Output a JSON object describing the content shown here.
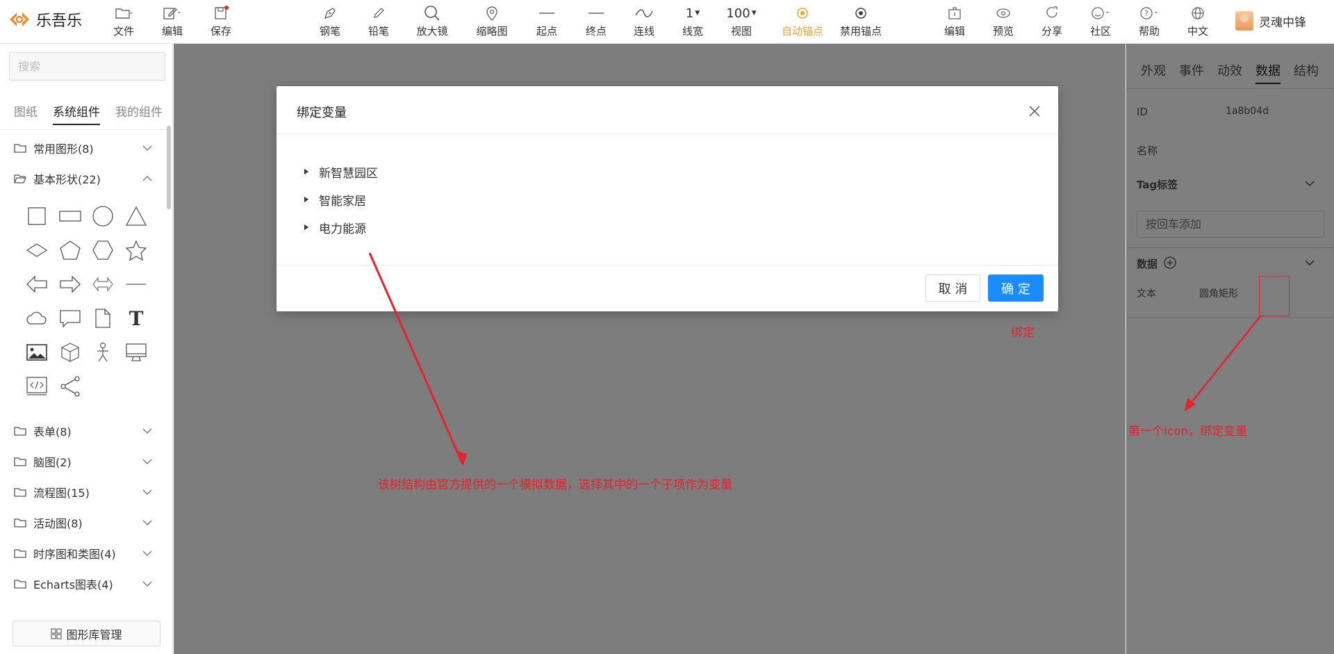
{
  "app": {
    "name": "乐吾乐"
  },
  "toolbar": {
    "left": [
      {
        "label": "文件",
        "icon": "folder-icon"
      },
      {
        "label": "编辑",
        "icon": "edit-icon"
      },
      {
        "label": "保存",
        "icon": "save-icon"
      }
    ],
    "center": [
      {
        "label": "钢笔",
        "icon": "pen-icon"
      },
      {
        "label": "铅笔",
        "icon": "pencil-icon"
      },
      {
        "label": "放大镜",
        "icon": "magnifier-icon"
      },
      {
        "label": "缩略图",
        "icon": "map-pin-icon"
      },
      {
        "label": "起点",
        "icon": "line-start-icon"
      },
      {
        "label": "终点",
        "icon": "line-end-icon"
      },
      {
        "label": "连线",
        "icon": "curve-icon"
      },
      {
        "label": "线宽",
        "value": "1"
      },
      {
        "label": "视图",
        "value": "100"
      },
      {
        "label": "自动锚点",
        "icon": "auto-anchor-icon",
        "active": true
      },
      {
        "label": "禁用锚点",
        "icon": "disable-anchor-icon"
      }
    ],
    "right": [
      {
        "label": "编辑",
        "icon": "edit-box-icon"
      },
      {
        "label": "预览",
        "icon": "eye-icon"
      },
      {
        "label": "分享",
        "icon": "share-icon"
      },
      {
        "label": "社区",
        "icon": "smile-icon"
      },
      {
        "label": "帮助",
        "icon": "help-icon"
      },
      {
        "label": "中文",
        "icon": "globe-icon"
      }
    ],
    "user": {
      "name": "灵魂中锋"
    }
  },
  "left_panel": {
    "search_placeholder": "搜索",
    "tabs": [
      "图纸",
      "系统组件",
      "我的组件"
    ],
    "active_tab": "系统组件",
    "groups": [
      {
        "label": "常用图形(8)",
        "expanded": false
      },
      {
        "label": "基本形状(22)",
        "expanded": true
      },
      {
        "label": "表单(8)",
        "expanded": false
      },
      {
        "label": "脑图(2)",
        "expanded": false
      },
      {
        "label": "流程图(15)",
        "expanded": false
      },
      {
        "label": "活动图(8)",
        "expanded": false
      },
      {
        "label": "时序图和类图(4)",
        "expanded": false
      },
      {
        "label": "Echarts图表(4)",
        "expanded": false
      }
    ],
    "shapes": [
      "square",
      "rectangle",
      "circle",
      "triangle",
      "diamond",
      "pentagon",
      "hexagon",
      "star",
      "left-arrow",
      "right-arrow",
      "double-arrow",
      "line",
      "cloud",
      "message",
      "file",
      "text",
      "image",
      "cube",
      "person",
      "monitor",
      "code",
      "share-node"
    ],
    "text_shape_glyph": "T",
    "library_button": "图形库管理"
  },
  "right_panel": {
    "tabs": [
      "外观",
      "事件",
      "动效",
      "数据",
      "结构"
    ],
    "active_tab": "数据",
    "id_label": "ID",
    "id_value": "1a8b04d",
    "name_label": "名称",
    "tag_label": "Tag标签",
    "tag_placeholder": "按回车添加",
    "data_label": "数据",
    "text_label": "文本",
    "text_value": "圆角矩形"
  },
  "dialog": {
    "title": "绑定变量",
    "tree": [
      "新智慧园区",
      "智能家居",
      "电力能源"
    ],
    "cancel": "取 消",
    "confirm": "确 定"
  },
  "annotations": {
    "bind_note": "绑定",
    "tree_note": "该树结构由官方提供的一个模拟数据，选择其中的一个子项作为变量",
    "icon_note": "第一个icon，绑定变量",
    "color": "#e8212b"
  }
}
